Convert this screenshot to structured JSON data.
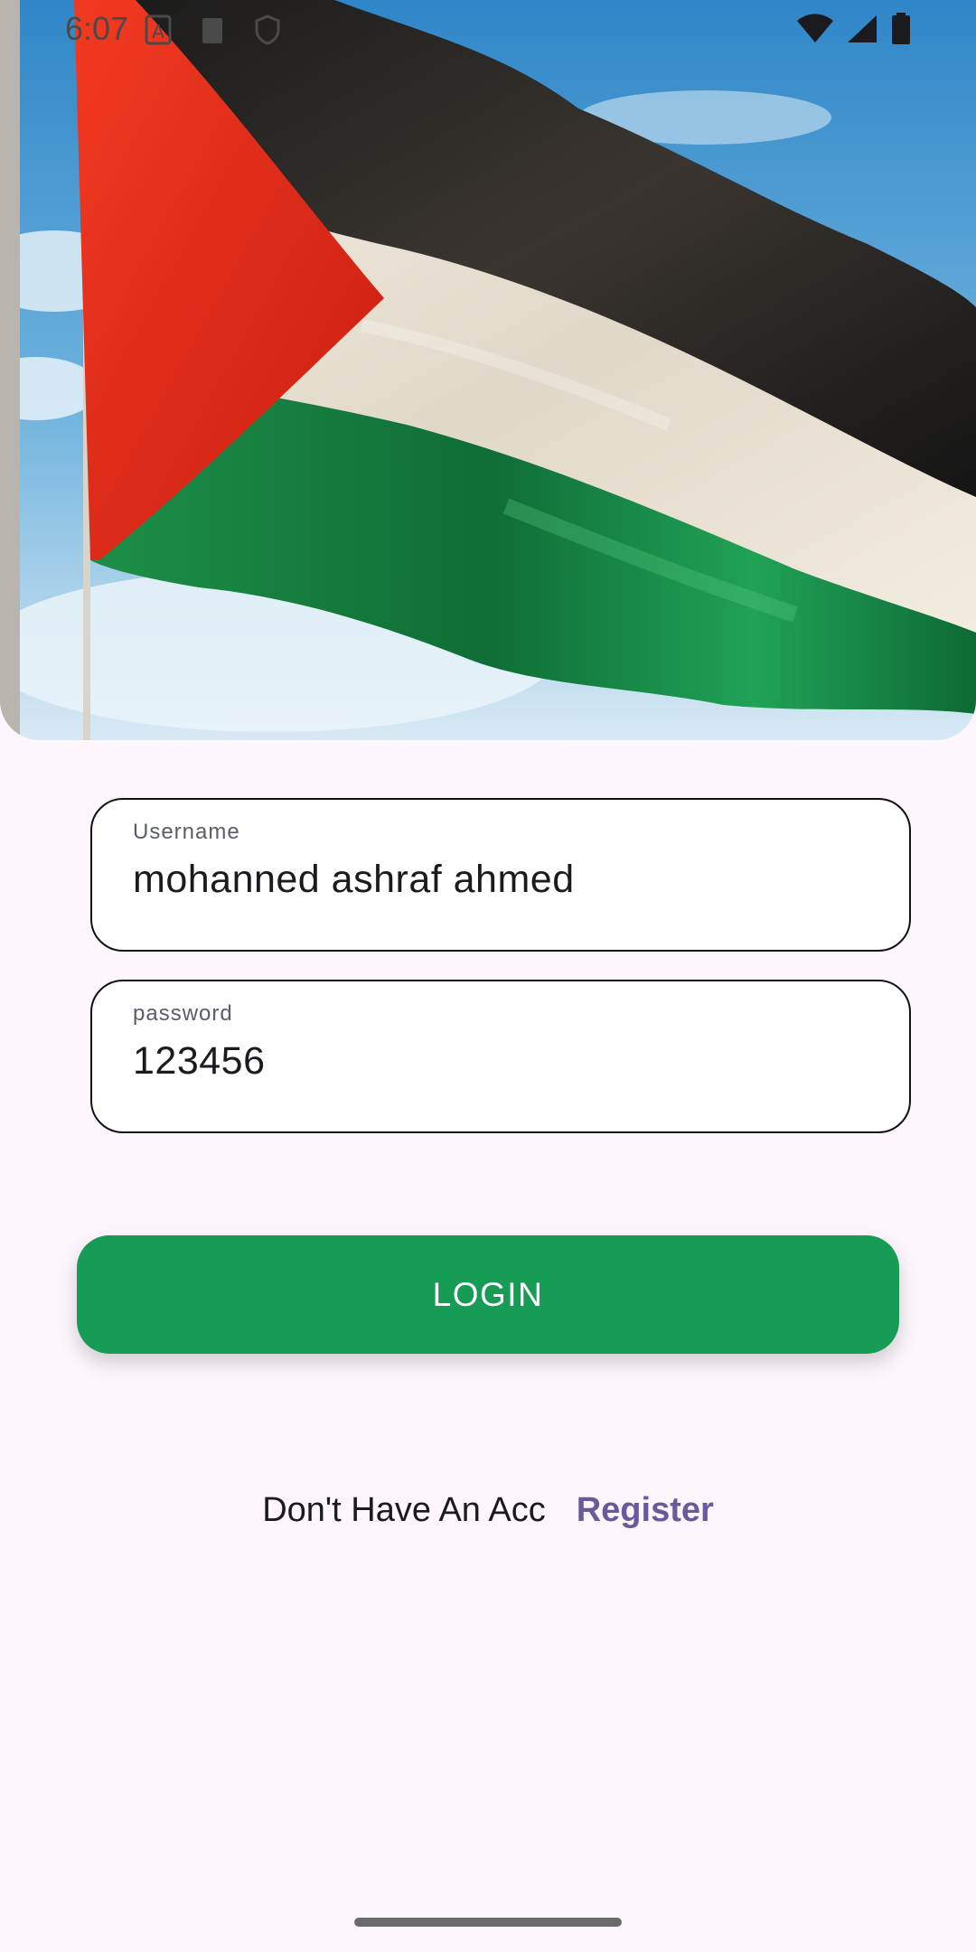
{
  "status_bar": {
    "time": "6:07",
    "notification_icons": [
      "alert-icon",
      "clipboard-icon",
      "shield-icon"
    ],
    "system_icons": [
      "wifi-icon",
      "signal-icon",
      "battery-icon"
    ]
  },
  "hero": {
    "image": "palestine-flag-icon"
  },
  "form": {
    "username": {
      "label": "Username",
      "value": "mohanned ashraf ahmed"
    },
    "password": {
      "label": "password",
      "value": "123456"
    }
  },
  "login_button": {
    "label": "LOGIN"
  },
  "register": {
    "prompt": "Don't Have An Acc",
    "link": "Register"
  },
  "colors": {
    "background": "#fdf7fd",
    "button": "#169c55",
    "link": "#6a5a99",
    "field_border": "#111111"
  }
}
